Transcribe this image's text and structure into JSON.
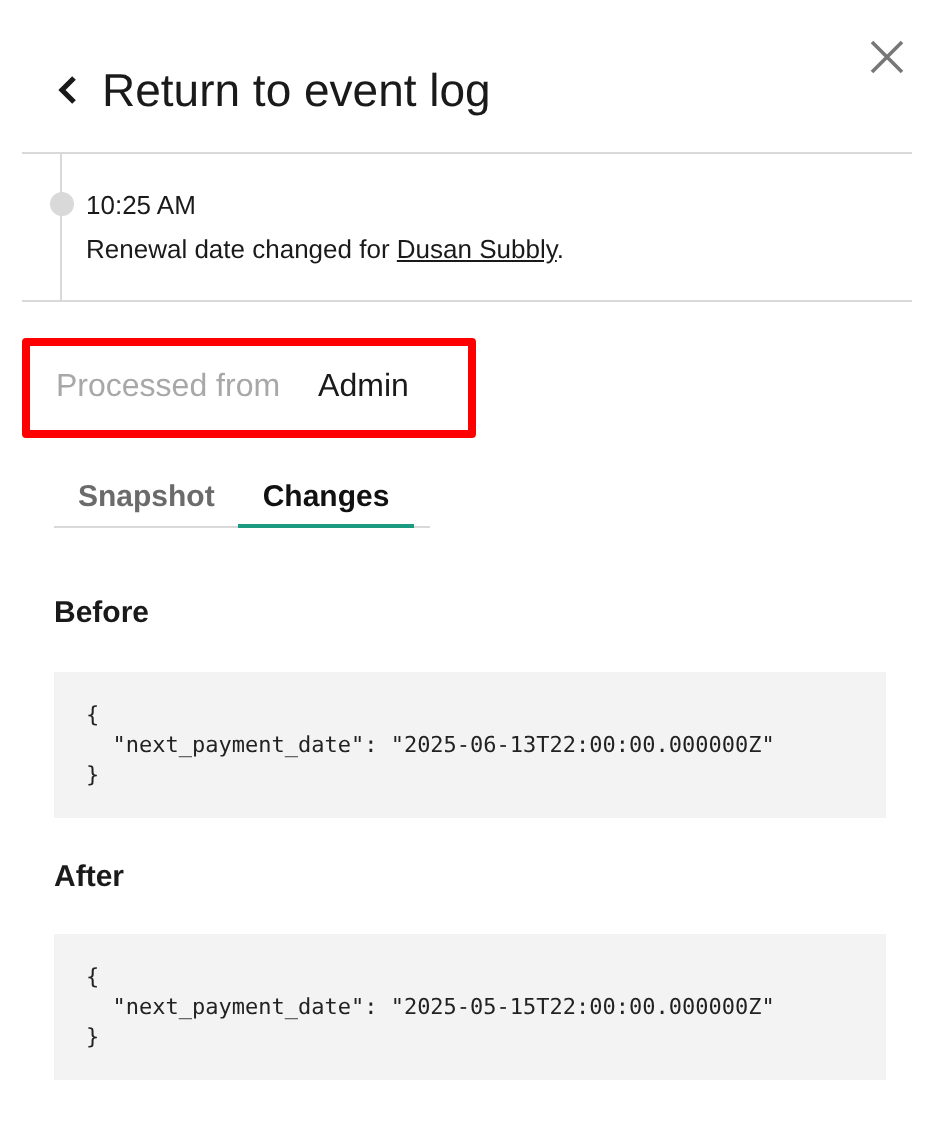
{
  "header": {
    "title": "Return to event log"
  },
  "event": {
    "time": "10:25 AM",
    "description": "Renewal date changed for",
    "link": "Dusan Subbly",
    "suffix": "."
  },
  "source": {
    "label": "Processed from",
    "value": "Admin",
    "highlighted": true
  },
  "tabs": [
    {
      "label": "Snapshot",
      "selected": false
    },
    {
      "label": "Changes",
      "selected": true
    }
  ],
  "sections": [
    {
      "title": "Before",
      "code": "{\n  \"next_payment_date\": \"2025-06-13T22:00:00.000000Z\"\n}"
    },
    {
      "title": "After",
      "code": "{\n  \"next_payment_date\": \"2025-05-15T22:00:00.000000Z\"\n}"
    }
  ]
}
